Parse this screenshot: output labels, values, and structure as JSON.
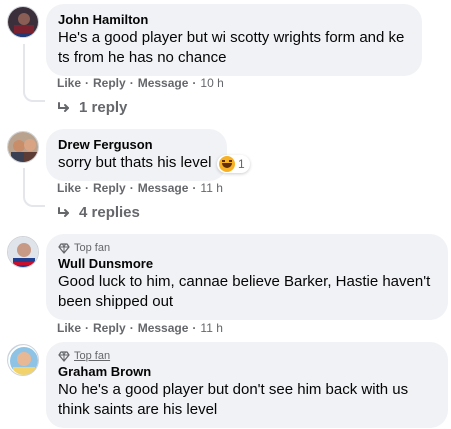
{
  "comments": [
    {
      "author": "John Hamilton",
      "text": "He's a good player but wi scotty wrights form and ke ts from he has no chance",
      "like": "Like",
      "reply": "Reply",
      "message": "Message",
      "time": "10 h",
      "replies": "1 reply"
    },
    {
      "author": "Drew Ferguson",
      "text": "sorry but thats his level",
      "reaction_count": "1",
      "like": "Like",
      "reply": "Reply",
      "message": "Message",
      "time": "11 h",
      "replies": "4 replies"
    },
    {
      "badge": "Top fan",
      "author": "Wull Dunsmore",
      "text": "Good luck to him, cannae believe Barker, Hastie haven't been shipped out",
      "like": "Like",
      "reply": "Reply",
      "message": "Message",
      "time": "11 h"
    },
    {
      "badge": "Top fan",
      "author": "Graham Brown",
      "text": "No he's a good player but don't see him back with us think saints are his level"
    }
  ],
  "separator": "·",
  "icons": {
    "reply_arrow": "reply-arrow-icon",
    "top_fan": "diamond-badge-icon",
    "reaction": "haha-reaction-icon"
  },
  "colors": {
    "bubble": "#f0f2f5",
    "meta": "#65676b",
    "text": "#050505"
  }
}
